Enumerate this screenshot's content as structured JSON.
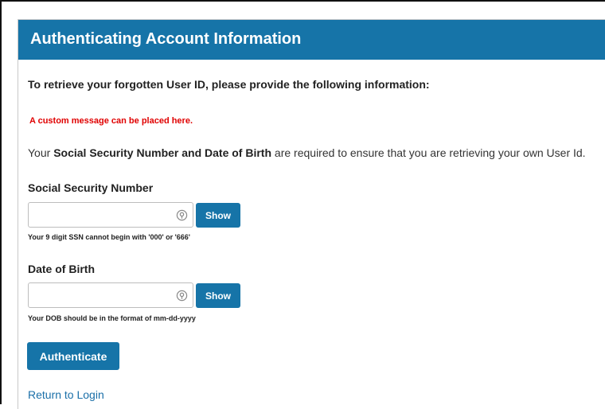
{
  "header": {
    "title": "Authenticating Account Information"
  },
  "form": {
    "intro": "To retrieve your forgotten User ID, please provide the following information:",
    "custom_message": "A custom message can be placed here.",
    "explanation": {
      "part1": "Your ",
      "bold1": "Social Security Number and Date of Birth",
      "part2": " are required to ensure that you are retrieving your own User Id."
    },
    "ssn": {
      "label": "Social Security Number",
      "value": "",
      "show_label": "Show",
      "hint": "Your 9 digit SSN cannot begin with '000' or '666'",
      "icon": "password-reveal-icon"
    },
    "dob": {
      "label": "Date of Birth",
      "value": "",
      "show_label": "Show",
      "hint": "Your DOB should be in the format of mm-dd-yyyy",
      "icon": "password-reveal-icon"
    },
    "authenticate_label": "Authenticate",
    "return_link": "Return to Login"
  },
  "colors": {
    "header_bg": "#1674a8",
    "button_bg": "#1674a8",
    "custom_message": "#e00000",
    "link": "#1a6fa8"
  }
}
